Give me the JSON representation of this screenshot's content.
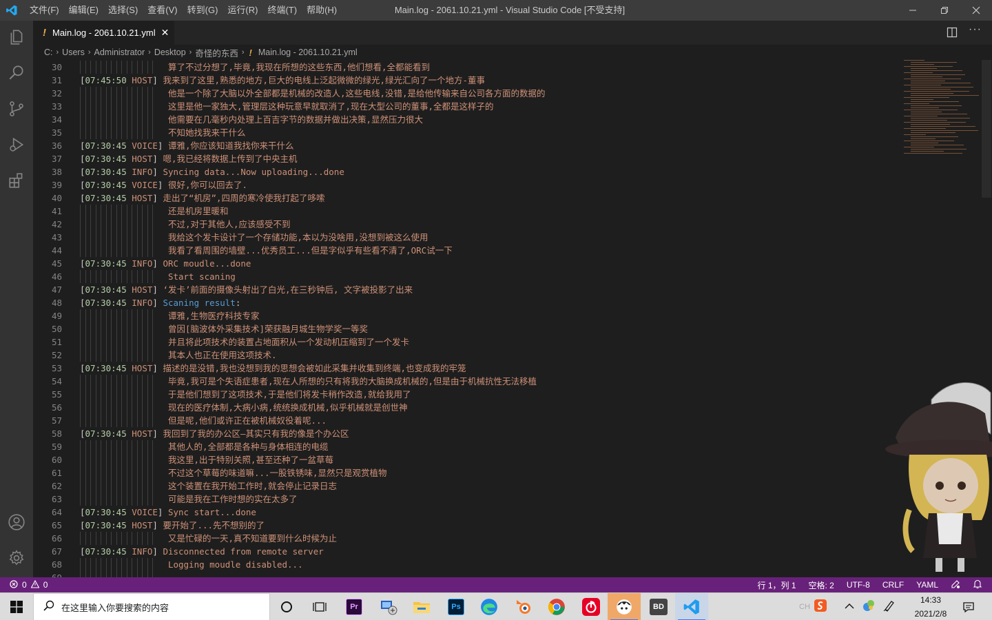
{
  "titlebar": {
    "menu": [
      "文件(F)",
      "编辑(E)",
      "选择(S)",
      "查看(V)",
      "转到(G)",
      "运行(R)",
      "终端(T)",
      "帮助(H)"
    ],
    "window_title": "Main.log - 2061.10.21.yml - Visual Studio Code [不受支持]"
  },
  "tab": {
    "label": "Main.log - 2061.10.21.yml",
    "modified_marker": "!",
    "close": "✕"
  },
  "breadcrumb": {
    "items": [
      "C:",
      "Users",
      "Administrator",
      "Desktop",
      "奇怪的东西"
    ],
    "file": "Main.log - 2061.10.21.yml",
    "marker": "!"
  },
  "editor": {
    "lines": [
      {
        "n": "30",
        "ts": "",
        "tag": "",
        "text": "算了不过分想了,毕竟,我现在所想的这些东西,他们想看,全都能看到"
      },
      {
        "n": "31",
        "ts": "07:45:50",
        "tag": "HOST",
        "text": "我来到了这里,熟悉的地方,巨大的电线上泛起微微的绿光,绿光汇向了一个地方-董事"
      },
      {
        "n": "32",
        "ts": "",
        "tag": "",
        "text": "他是一个除了大脑以外全部都是机械的改造人,这些电线,没错,是给他传输来自公司各方面的数据的"
      },
      {
        "n": "33",
        "ts": "",
        "tag": "",
        "text": "这里是他一家独大,管理层这种玩意早就取消了,现在大型公司的董事,全都是这样子的"
      },
      {
        "n": "34",
        "ts": "",
        "tag": "",
        "text": "他需要在几毫秒内处理上百吉字节的数据并做出决策,显然压力很大"
      },
      {
        "n": "35",
        "ts": "",
        "tag": "",
        "text": "不知她找我来干什么"
      },
      {
        "n": "36",
        "ts": "07:30:45",
        "tag": "VOICE",
        "text": "谭雅,你应该知道我找你来干什么"
      },
      {
        "n": "37",
        "ts": "07:30:45",
        "tag": "HOST",
        "text": "嗯,我已经将数据上传到了中央主机"
      },
      {
        "n": "38",
        "ts": "07:30:45",
        "tag": "INFO",
        "text": "Syncing data...Now uploading...done"
      },
      {
        "n": "39",
        "ts": "07:30:45",
        "tag": "VOICE",
        "text": "很好,你可以回去了."
      },
      {
        "n": "40",
        "ts": "07:30:45",
        "tag": "HOST",
        "text": "走出了“机房”,四周的寒冷使我打起了哆嗦"
      },
      {
        "n": "41",
        "ts": "",
        "tag": "",
        "text": "还是机房里暖和"
      },
      {
        "n": "42",
        "ts": "",
        "tag": "",
        "text": "不过,对于其他人,应该感受不到"
      },
      {
        "n": "43",
        "ts": "",
        "tag": "",
        "text": "我给这个发卡设计了一个存储功能,本以为没啥用,没想到被这么使用"
      },
      {
        "n": "44",
        "ts": "",
        "tag": "",
        "text": "我看了看周围的墙壁...优秀员工...但是字似乎有些看不清了,ORC试一下"
      },
      {
        "n": "45",
        "ts": "07:30:45",
        "tag": "INFO",
        "text": "ORC moudle...done"
      },
      {
        "n": "46",
        "ts": "",
        "tag": "",
        "text": "Start scaning"
      },
      {
        "n": "47",
        "ts": "07:30:45",
        "tag": "HOST",
        "text": "‘发卡’前面的摄像头射出了白光,在三秒钟后, 文字被投影了出来"
      },
      {
        "n": "48",
        "ts": "07:30:45",
        "tag": "INFO",
        "text": "",
        "key": "Scaning result",
        "colon": ":"
      },
      {
        "n": "49",
        "ts": "",
        "tag": "",
        "text": "谭雅,生物医疗科技专家"
      },
      {
        "n": "50",
        "ts": "",
        "tag": "",
        "text": "曾因[脑波体外采集技术]荣获融月城生物学奖一等奖"
      },
      {
        "n": "51",
        "ts": "",
        "tag": "",
        "text": "并且将此项技术的装置占地面积从一个发动机压缩到了一个发卡"
      },
      {
        "n": "52",
        "ts": "",
        "tag": "",
        "text": "其本人也正在使用这项技术."
      },
      {
        "n": "53",
        "ts": "07:30:45",
        "tag": "HOST",
        "text": "描述的是没错,我也没想到我的思想会被如此采集并收集到终端,也变成我的牢笼"
      },
      {
        "n": "54",
        "ts": "",
        "tag": "",
        "text": "毕竟,我可是个失语症患者,现在人所想的只有将我的大脑换成机械的,但是由于机械抗性无法移植"
      },
      {
        "n": "55",
        "ts": "",
        "tag": "",
        "text": "于是他们想到了这项技术,于是他们将发卡稍作改造,就给我用了"
      },
      {
        "n": "56",
        "ts": "",
        "tag": "",
        "text": "现在的医疗体制,大病小病,统统换成机械,似乎机械就是创世神"
      },
      {
        "n": "57",
        "ts": "",
        "tag": "",
        "text": "但是呢,他们或许正在被机械奴役着呢..."
      },
      {
        "n": "58",
        "ts": "07:30:45",
        "tag": "HOST",
        "text": "我回到了我的办公区—其实只有我的像是个办公区"
      },
      {
        "n": "59",
        "ts": "",
        "tag": "",
        "text": "其他人的,全部都是各种与身体相连的电缆"
      },
      {
        "n": "60",
        "ts": "",
        "tag": "",
        "text": "我这里,出于特别关照,甚至还种了一盆草莓"
      },
      {
        "n": "61",
        "ts": "",
        "tag": "",
        "text": "不过这个草莓的味道嘛...一股铁锈味,显然只是观赏植物"
      },
      {
        "n": "62",
        "ts": "",
        "tag": "",
        "text": "这个装置在我开始工作时,就会停止记录日志"
      },
      {
        "n": "63",
        "ts": "",
        "tag": "",
        "text": "可能是我在工作时想的实在太多了"
      },
      {
        "n": "64",
        "ts": "07:30:45",
        "tag": "VOICE",
        "text": "Sync start...done"
      },
      {
        "n": "65",
        "ts": "07:30:45",
        "tag": "HOST",
        "text": "要开始了...先不想别的了"
      },
      {
        "n": "66",
        "ts": "",
        "tag": "",
        "text": "又是忙碌的一天,真不知道要到什么时候为止"
      },
      {
        "n": "67",
        "ts": "07:30:45",
        "tag": "INFO",
        "text": "Disconnected from remote server"
      },
      {
        "n": "68",
        "ts": "",
        "tag": "",
        "text": "Logging moudle disabled..."
      },
      {
        "n": "69",
        "ts": "",
        "tag": "",
        "text": ""
      }
    ]
  },
  "statusbar": {
    "errors": "0",
    "warnings": "0",
    "position": "行 1，列 1",
    "spaces": "空格: 2",
    "encoding": "UTF-8",
    "eol": "CRLF",
    "language": "YAML"
  },
  "taskbar": {
    "search_placeholder": "在这里输入你要搜索的内容",
    "apps": [
      "cortana-icon",
      "task-view-icon",
      "premiere-icon",
      "network-tool-icon",
      "file-explorer-icon",
      "photoshop-icon",
      "edge-icon",
      "blender-icon",
      "chrome-icon",
      "netease-music-icon",
      "game-app-icon",
      "bd-app-icon",
      "vscode-icon"
    ],
    "premiere_label": "Pr",
    "photoshop_label": "Ps",
    "bd_label": "BD",
    "ime_label": "CH",
    "time": "14:33",
    "date": "2021/2/8"
  },
  "colors": {
    "statusbar": "#68217a",
    "titlebar": "#3c3c3c",
    "activitybar": "#333333",
    "editor": "#1e1e1e",
    "string": "#ce9178",
    "key": "#569cd6",
    "timestamp": "#b5cea8"
  }
}
